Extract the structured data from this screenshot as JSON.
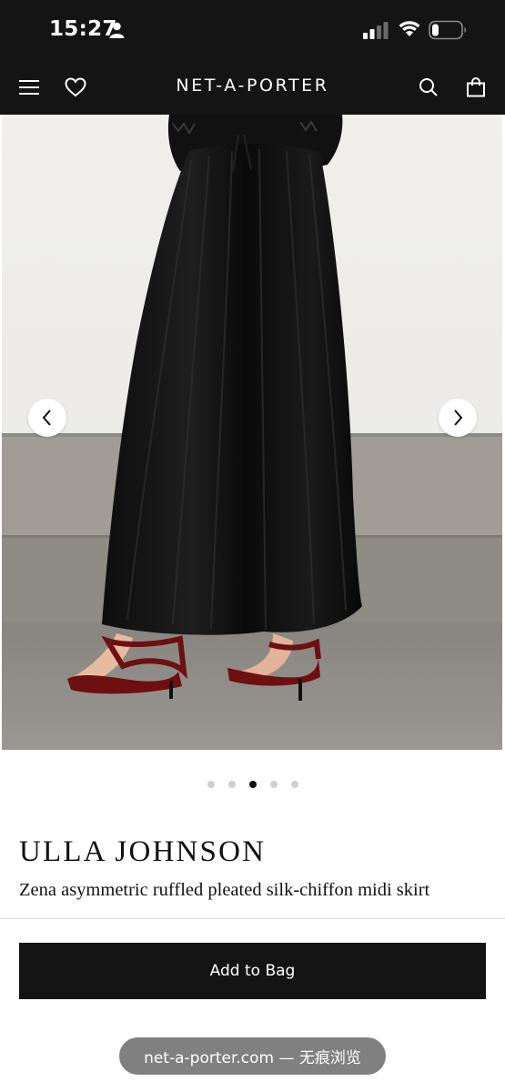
{
  "status_bar": {
    "time": "15:27",
    "icons": [
      "person-icon",
      "cellular-signal-icon",
      "wifi-icon",
      "battery-icon"
    ]
  },
  "nav": {
    "brand": "NET-A-PORTER",
    "icons": [
      "menu-icon",
      "heart-icon",
      "search-icon",
      "shopping-bag-icon"
    ]
  },
  "gallery": {
    "image_count": 5,
    "active_index": 3,
    "arrows": [
      "chevron-left-icon",
      "chevron-right-icon"
    ]
  },
  "product": {
    "designer": "ULLA JOHNSON",
    "title": "Zena asymmetric ruffled pleated silk-chiffon midi skirt",
    "add_to_bag_label": "Add to Bag"
  },
  "browser": {
    "url_text": "net-a-porter.com — 无痕浏览"
  },
  "colors": {
    "header_bg": "#141414",
    "button_bg": "#141414",
    "dot_active": "#111111",
    "dot_inactive": "#cfcfcf"
  }
}
